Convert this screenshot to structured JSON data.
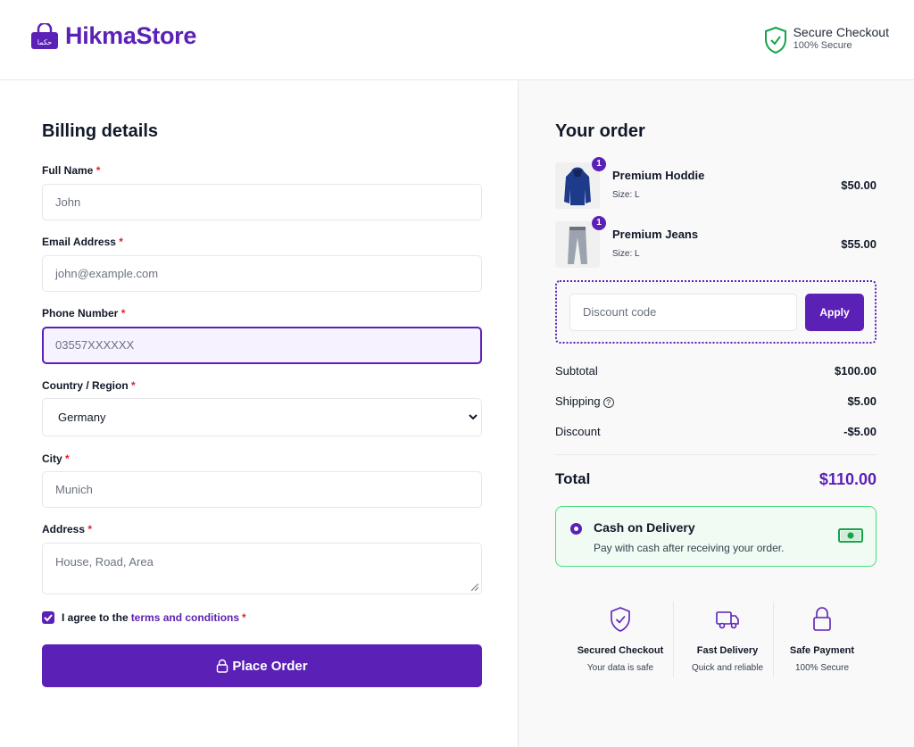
{
  "header": {
    "brand": "HikmaStore",
    "bag_label": "حكما",
    "secure_title": "Secure Checkout",
    "secure_sub": "100% Secure"
  },
  "billing": {
    "title": "Billing details",
    "fields": {
      "full_name": {
        "label": "Full Name",
        "placeholder": "John"
      },
      "email": {
        "label": "Email Address",
        "placeholder": "john@example.com"
      },
      "phone": {
        "label": "Phone Number",
        "placeholder": "03557XXXXXX"
      },
      "country": {
        "label": "Country / Region",
        "value": "Germany"
      },
      "city": {
        "label": "City",
        "placeholder": "Munich"
      },
      "address": {
        "label": "Address",
        "placeholder": "House, Road, Area"
      }
    },
    "required_mark": "*",
    "agree_text": "I agree to the",
    "agree_link": "terms and conditions",
    "agree_checked": true,
    "place_order": "Place Order"
  },
  "order": {
    "title": "Your order",
    "items": [
      {
        "name": "Premium Hoddie",
        "size": "Size: L",
        "price": "$50.00",
        "qty": "1",
        "image": "hoodie-image"
      },
      {
        "name": "Premium Jeans",
        "size": "Size: L",
        "price": "$55.00",
        "qty": "1",
        "image": "jeans-image"
      }
    ],
    "discount_placeholder": "Discount code",
    "apply": "Apply",
    "subtotal_label": "Subtotal",
    "subtotal": "$100.00",
    "shipping_label": "Shipping",
    "shipping": "$5.00",
    "discount_label": "Discount",
    "discount": "-$5.00",
    "total_label": "Total",
    "total": "$110.00",
    "payment": {
      "title": "Cash on Delivery",
      "desc": "Pay with cash after receiving your order.",
      "selected": true
    },
    "features": [
      {
        "title": "Secured Checkout",
        "sub": "Your data is safe",
        "icon": "shield-check-icon"
      },
      {
        "title": "Fast Delivery",
        "sub": "Quick and reliable",
        "icon": "truck-icon"
      },
      {
        "title": "Safe Payment",
        "sub": "100% Secure",
        "icon": "lock-icon"
      }
    ]
  },
  "colors": {
    "brand": "#5b21b6",
    "success_border": "#4ade80",
    "required": "#dc2626"
  }
}
